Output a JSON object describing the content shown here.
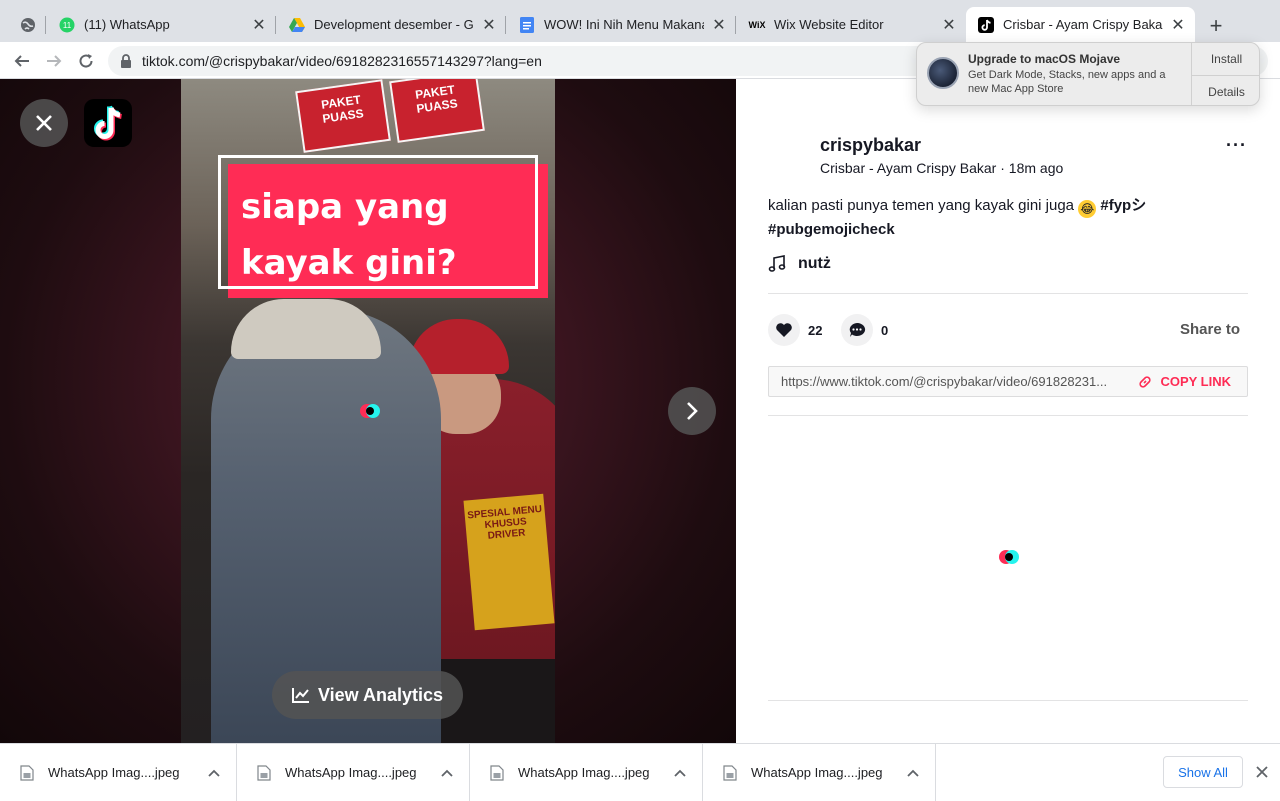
{
  "browser": {
    "tabs": [
      {
        "title": "",
        "icon": "globe-icon"
      },
      {
        "title": "(11) WhatsApp",
        "icon": "whatsapp-icon",
        "badge": "11"
      },
      {
        "title": "Development desember - Go",
        "icon": "google-drive-icon"
      },
      {
        "title": "WOW! Ini Nih Menu Makanan",
        "icon": "google-docs-icon"
      },
      {
        "title": "Wix Website Editor",
        "icon": "wix-icon",
        "icon_text": "WiX"
      },
      {
        "title": "Crisbar - Ayam Crispy Bakar",
        "icon": "tiktok-icon",
        "active": true
      }
    ],
    "url": "tiktok.com/@crispybakar/video/6918282316557143297?lang=en"
  },
  "notification": {
    "title": "Upgrade to macOS Mojave",
    "body": "Get Dark Mode, Stacks, new apps and a new Mac App Store",
    "install_label": "Install",
    "details_label": "Details"
  },
  "video": {
    "caption_line1": "siapa yang",
    "caption_line2": "kayak gini?",
    "sign_text": "PAKET PUASS",
    "promo_text": "SPESIAL MENU KHUSUS DRIVER",
    "analytics_label": "View Analytics"
  },
  "post": {
    "username": "crispybakar",
    "subline": "Crisbar - Ayam Crispy Bakar · 18m ago",
    "description": "kalian pasti punya temen yang kayak gini juga",
    "hashtag1": "#fypシ",
    "hashtag2": "#pubgemojicheck",
    "music": "nutż",
    "likes": "22",
    "comments": "0",
    "share_label": "Share to",
    "link": "https://www.tiktok.com/@crispybakar/video/691828231...",
    "copy_label": "COPY LINK",
    "more_label": "···"
  },
  "downloads": {
    "items": [
      {
        "name": "WhatsApp Imag....jpeg"
      },
      {
        "name": "WhatsApp Imag....jpeg"
      },
      {
        "name": "WhatsApp Imag....jpeg"
      },
      {
        "name": "WhatsApp Imag....jpeg"
      }
    ],
    "show_all_label": "Show All"
  },
  "colors": {
    "tiktok_red": "#fe2c55",
    "tiktok_cyan": "#25f4ee",
    "chrome_tabstrip": "#dee1e6",
    "link_blue": "#1a73e8"
  }
}
